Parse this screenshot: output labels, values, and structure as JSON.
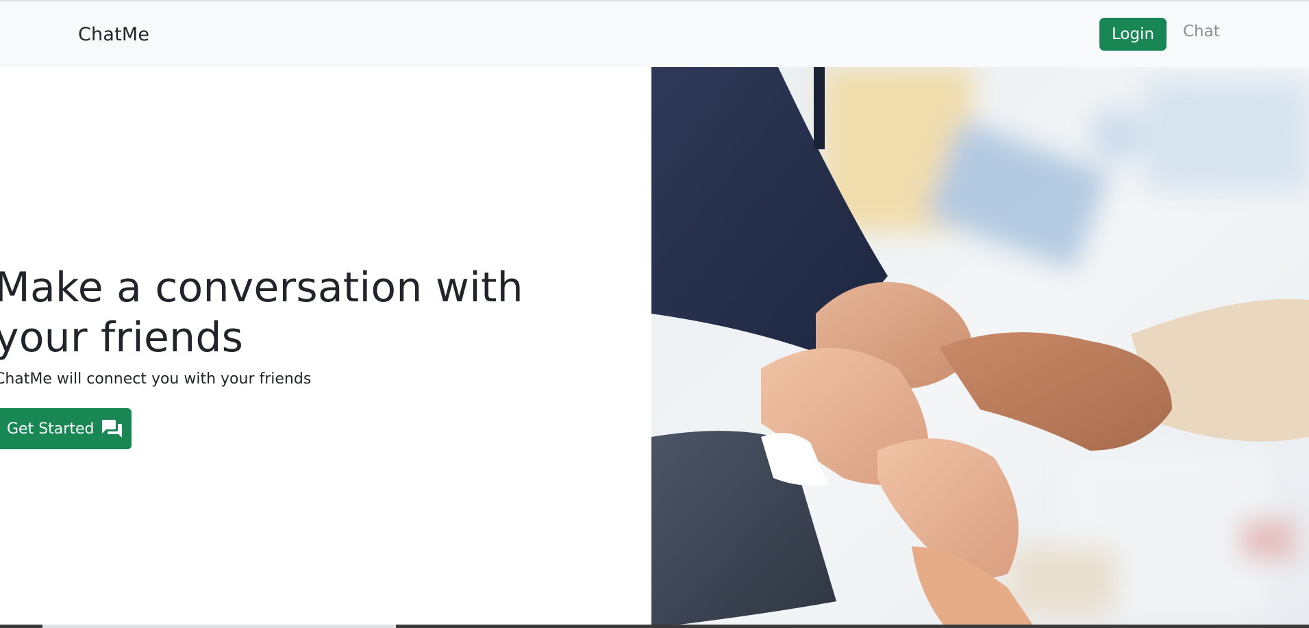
{
  "navbar": {
    "brand": "ChatMe",
    "login_label": "Login",
    "chat_label": "Chat"
  },
  "hero": {
    "title": "Make a conversation with your friends",
    "subtitle": "ChatMe will connect you with your friends",
    "cta_label": "Get Started",
    "cta_icon": "chat-bubbles-icon",
    "image_icon": "team-hands-photo"
  },
  "colors": {
    "accent": "#198754",
    "navbar_bg": "#f8f9fa",
    "text": "#212529",
    "muted_link": "#8a8f94"
  }
}
